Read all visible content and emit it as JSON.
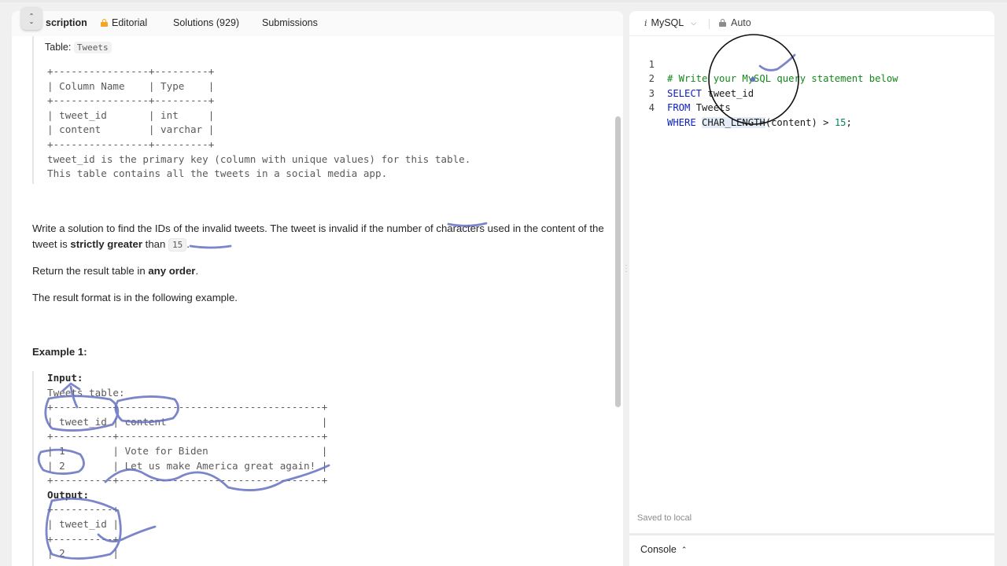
{
  "tabs": {
    "description": "scription",
    "editorial": "Editorial",
    "solutions": "Solutions (929)",
    "submissions": "Submissions"
  },
  "cut_label": {
    "prefix": "Table:",
    "code": "Tweets"
  },
  "schema_lines": [
    "+----------------+---------+",
    "| Column Name    | Type    |",
    "+----------------+---------+",
    "| tweet_id       | int     |",
    "| content        | varchar |",
    "+----------------+---------+",
    "tweet_id is the primary key (column with unique values) for this table.",
    "This table contains all the tweets in a social media app."
  ],
  "problem": {
    "part1": "Write a solution to find the IDs of the invalid tweets. The tweet is invalid if the number of characters used in the content of the tweet is ",
    "bold": "strictly greater",
    "part2": " than ",
    "code": "15",
    "part3": "."
  },
  "return_text": {
    "part1": "Return the result table in ",
    "bold": "any order",
    "part2": "."
  },
  "format_text": "The result format is in the following example.",
  "example_heading": "Example 1:",
  "example": {
    "input_label": "Input:",
    "lines1": [
      "Tweets table:",
      "+----------+----------------------------------+",
      "| tweet_id | content                          |",
      "+----------+----------------------------------+",
      "| 1        | Vote for Biden                   |",
      "| 2        | Let us make America great again! |",
      "+----------+----------------------------------+"
    ],
    "output_label": "Output:",
    "lines2": [
      "+----------+",
      "| tweet_id |",
      "+----------+",
      "| 2        |",
      "+----------+"
    ]
  },
  "editor": {
    "language": "MySQL",
    "auto_label": "Auto",
    "code": [
      {
        "n": "1",
        "t": "# Write your MySQL query statement below"
      },
      {
        "n": "2",
        "kw": "SELECT",
        "rest": " tweet_id"
      },
      {
        "n": "3",
        "kw": "FROM",
        "rest": " Tweets"
      },
      {
        "n": "4",
        "kw": "WHERE",
        "fn": "CHAR_LENGTH",
        "mid": "(content) > ",
        "num": "15",
        "end": ";"
      }
    ],
    "saved_status": "Saved to local"
  },
  "console_label": "Console",
  "colors": {
    "comment": "#11891a",
    "keyword": "#0b1dbd",
    "number": "#098658",
    "annotation_pen": "#6470c0",
    "editorial_lock": "#f5a524"
  },
  "icons": [
    "lock-icon",
    "chevron-down-icon",
    "chevron-up-icon",
    "expand-icon",
    "mysql-info-icon"
  ]
}
